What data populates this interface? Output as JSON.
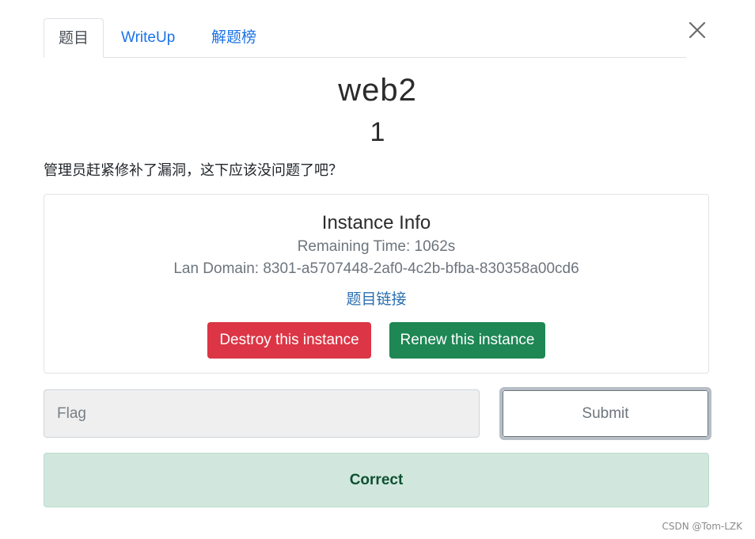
{
  "tabs": [
    {
      "label": "题目",
      "active": true
    },
    {
      "label": "WriteUp",
      "active": false
    },
    {
      "label": "解题榜",
      "active": false
    }
  ],
  "close_icon": "close-icon",
  "challenge": {
    "name": "web2",
    "points": "1",
    "description": "管理员赶紧修补了漏洞，这下应该没问题了吧？"
  },
  "instance": {
    "title": "Instance Info",
    "remaining_time": "Remaining Time: 1062s",
    "lan_domain": "Lan Domain: 8301-a5707448-2af0-4c2b-bfba-830358a00cd6",
    "link_label": "题目链接",
    "destroy_label": "Destroy this instance",
    "renew_label": "Renew this instance"
  },
  "flag_form": {
    "placeholder": "Flag",
    "value": "",
    "submit_label": "Submit"
  },
  "result": {
    "message": "Correct"
  },
  "watermark": "CSDN @Tom-LZK",
  "colors": {
    "link": "#1a73e8",
    "danger": "#dc3545",
    "success": "#1e8754",
    "alert_bg": "#d1e7dd",
    "alert_text": "#0f5132"
  }
}
